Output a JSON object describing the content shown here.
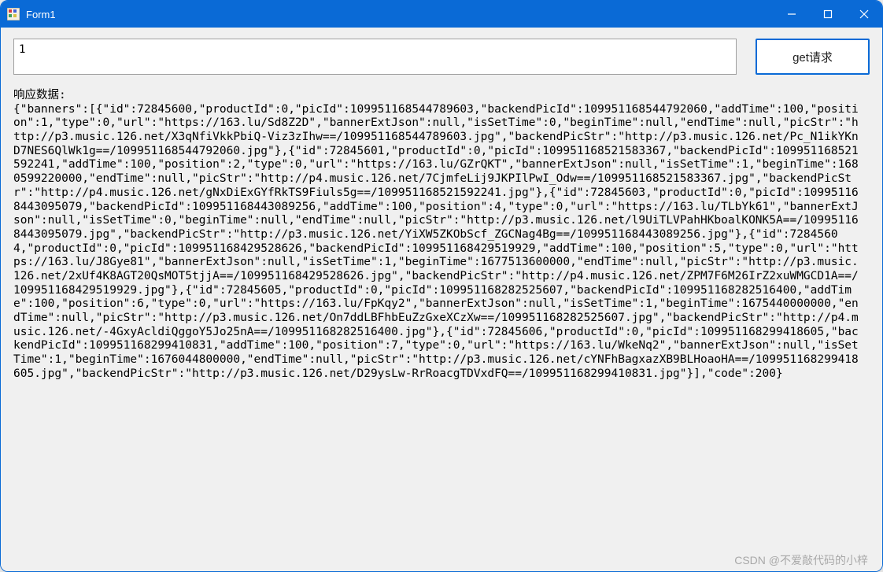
{
  "window": {
    "title": "Form1"
  },
  "form": {
    "textboxValue": "1",
    "getButtonLabel": "get请求"
  },
  "response": {
    "label": "响应数据:",
    "body": "{\"banners\":[{\"id\":72845600,\"productId\":0,\"picId\":109951168544789603,\"backendPicId\":109951168544792060,\"addTime\":100,\"position\":1,\"type\":0,\"url\":\"https://163.lu/Sd8Z2D\",\"bannerExtJson\":null,\"isSetTime\":0,\"beginTime\":null,\"endTime\":null,\"picStr\":\"http://p3.music.126.net/X3qNfiVkkPbiQ-Viz3zIhw==/109951168544789603.jpg\",\"backendPicStr\":\"http://p3.music.126.net/Pc_N1ikYKnD7NES6QlWk1g==/109951168544792060.jpg\"},{\"id\":72845601,\"productId\":0,\"picId\":109951168521583367,\"backendPicId\":109951168521592241,\"addTime\":100,\"position\":2,\"type\":0,\"url\":\"https://163.lu/GZrQKT\",\"bannerExtJson\":null,\"isSetTime\":1,\"beginTime\":1680599220000,\"endTime\":null,\"picStr\":\"http://p4.music.126.net/7CjmfeLij9JKPIlPwI_Odw==/109951168521583367.jpg\",\"backendPicStr\":\"http://p4.music.126.net/gNxDiExGYfRkTS9Fiuls5g==/109951168521592241.jpg\"},{\"id\":72845603,\"productId\":0,\"picId\":109951168443095079,\"backendPicId\":109951168443089256,\"addTime\":100,\"position\":4,\"type\":0,\"url\":\"https://163.lu/TLbYk61\",\"bannerExtJson\":null,\"isSetTime\":0,\"beginTime\":null,\"endTime\":null,\"picStr\":\"http://p3.music.126.net/l9UiTLVPahHKboalKONK5A==/109951168443095079.jpg\",\"backendPicStr\":\"http://p3.music.126.net/YiXW5ZKObScf_ZGCNag4Bg==/109951168443089256.jpg\"},{\"id\":72845604,\"productId\":0,\"picId\":109951168429528626,\"backendPicId\":109951168429519929,\"addTime\":100,\"position\":5,\"type\":0,\"url\":\"https://163.lu/J8Gye81\",\"bannerExtJson\":null,\"isSetTime\":1,\"beginTime\":1677513600000,\"endTime\":null,\"picStr\":\"http://p3.music.126.net/2xUf4K8AGT20QsMOT5tjjA==/109951168429528626.jpg\",\"backendPicStr\":\"http://p4.music.126.net/ZPM7F6M26IrZ2xuWMGCD1A==/109951168429519929.jpg\"},{\"id\":72845605,\"productId\":0,\"picId\":109951168282525607,\"backendPicId\":109951168282516400,\"addTime\":100,\"position\":6,\"type\":0,\"url\":\"https://163.lu/FpKqy2\",\"bannerExtJson\":null,\"isSetTime\":1,\"beginTime\":1675440000000,\"endTime\":null,\"picStr\":\"http://p3.music.126.net/On7ddLBFhbEuZzGxeXCzXw==/109951168282525607.jpg\",\"backendPicStr\":\"http://p4.music.126.net/-4GxyAcldiQggoY5Jo25nA==/109951168282516400.jpg\"},{\"id\":72845606,\"productId\":0,\"picId\":109951168299418605,\"backendPicId\":109951168299410831,\"addTime\":100,\"position\":7,\"type\":0,\"url\":\"https://163.lu/WkeNq2\",\"bannerExtJson\":null,\"isSetTime\":1,\"beginTime\":1676044800000,\"endTime\":null,\"picStr\":\"http://p3.music.126.net/cYNFhBagxazXB9BLHoaoHA==/109951168299418605.jpg\",\"backendPicStr\":\"http://p3.music.126.net/D29ysLw-RrRoacgTDVxdFQ==/109951168299410831.jpg\"}],\"code\":200}"
  },
  "watermark": "CSDN @不爱敲代码的小梓"
}
